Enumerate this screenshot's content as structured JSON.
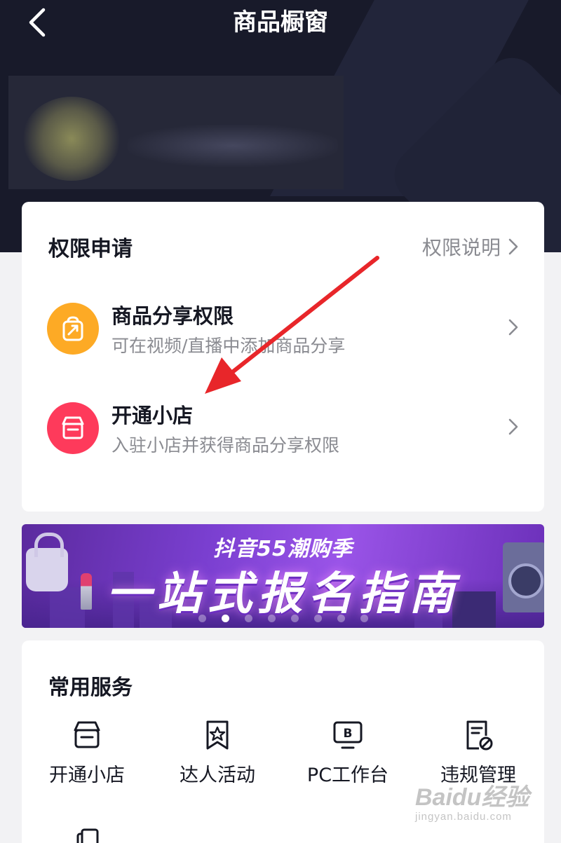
{
  "header": {
    "title": "商品橱窗"
  },
  "permission_card": {
    "title": "权限申请",
    "explain_link": "权限说明",
    "items": [
      {
        "title": "商品分享权限",
        "subtitle": "可在视频/直播中添加商品分享",
        "icon": "share-bag-icon",
        "color": "#fdaa25"
      },
      {
        "title": "开通小店",
        "subtitle": "入驻小店并获得商品分享权限",
        "icon": "store-icon",
        "color": "#fe3a5b"
      }
    ]
  },
  "banner": {
    "subtitle": "抖音55潮购季",
    "headline": "一站式报名指南",
    "carousel_active_index": 1,
    "carousel_count": 8
  },
  "services": {
    "title": "常用服务",
    "items": [
      {
        "label": "开通小店",
        "icon": "store-icon"
      },
      {
        "label": "达人活动",
        "icon": "star-bookmark-icon"
      },
      {
        "label": "PC工作台",
        "icon": "monitor-b-icon"
      },
      {
        "label": "违规管理",
        "icon": "prohibited-doc-icon"
      }
    ]
  },
  "watermark": {
    "brand": "Baidu经验",
    "url": "jingyan.baidu.com"
  },
  "colors": {
    "header_bg": "#181a2a",
    "page_bg": "#f2f2f4",
    "annotation_arrow": "#e8262a"
  }
}
